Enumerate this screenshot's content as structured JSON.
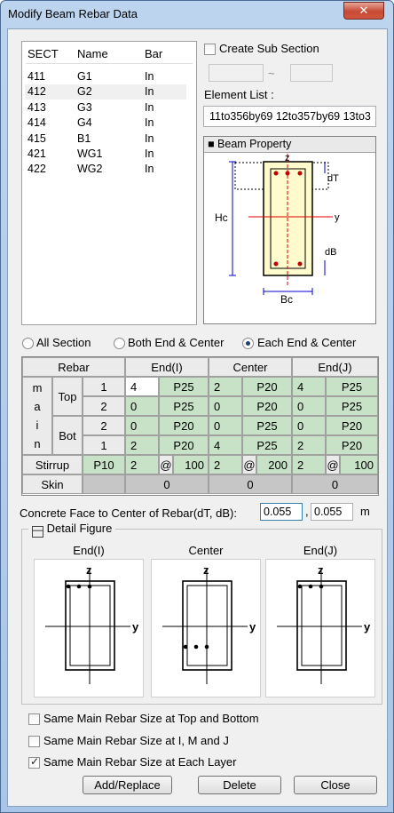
{
  "window": {
    "title": "Modify Beam Rebar Data",
    "close": "✕"
  },
  "sections": {
    "headers": [
      "SECT",
      "Name",
      "Bar"
    ],
    "rows": [
      {
        "sect": "411",
        "name": "G1",
        "bar": "In"
      },
      {
        "sect": "412",
        "name": "G2",
        "bar": "In"
      },
      {
        "sect": "413",
        "name": "G3",
        "bar": "In"
      },
      {
        "sect": "414",
        "name": "G4",
        "bar": "In"
      },
      {
        "sect": "415",
        "name": "B1",
        "bar": "In"
      },
      {
        "sect": "421",
        "name": "WG1",
        "bar": "In"
      },
      {
        "sect": "422",
        "name": "WG2",
        "bar": "In"
      }
    ]
  },
  "sub_section": {
    "label": "Create Sub Section",
    "dash": "~"
  },
  "element_list": {
    "label": "Element List :",
    "value": "11to356by69 12to357by69 13to3"
  },
  "beam_property": {
    "title": "Beam Property",
    "z": "z",
    "y": "y",
    "dT": "dT",
    "dB": "dB",
    "Hc": "Hc",
    "Bc": "Bc"
  },
  "positions": {
    "all": "All Section",
    "both": "Both End & Center",
    "each": "Each End & Center",
    "selected": "each"
  },
  "rebar_table": {
    "h_rebar": "Rebar",
    "h_endi": "End(I)",
    "h_center": "Center",
    "h_endj": "End(J)",
    "main": "m a i n",
    "top": "Top",
    "bot": "Bot",
    "rows": [
      {
        "layer": "1",
        "i_n": "4",
        "i_s": "P25",
        "c_n": "2",
        "c_s": "P20",
        "j_n": "4",
        "j_s": "P25"
      },
      {
        "layer": "2",
        "i_n": "0",
        "i_s": "P25",
        "c_n": "0",
        "c_s": "P20",
        "j_n": "0",
        "j_s": "P25"
      },
      {
        "layer": "2",
        "i_n": "0",
        "i_s": "P20",
        "c_n": "0",
        "c_s": "P25",
        "j_n": "0",
        "j_s": "P20"
      },
      {
        "layer": "1",
        "i_n": "2",
        "i_s": "P20",
        "c_n": "4",
        "c_s": "P25",
        "j_n": "2",
        "j_s": "P20"
      }
    ],
    "stirrup": {
      "label": "Stirrup",
      "size": "P10",
      "at": "@",
      "i_n": "2",
      "i_s": "100",
      "c_n": "2",
      "c_s": "200",
      "j_n": "2",
      "j_s": "100"
    },
    "skin": {
      "label": "Skin",
      "i": "0",
      "c": "0",
      "j": "0"
    }
  },
  "cover": {
    "label": "Concrete Face to Center of Rebar(dT, dB):",
    "dT": "0.055",
    "comma": ",",
    "dB": "0.055",
    "unit": "m"
  },
  "detail": {
    "label": "Detail Figure",
    "toggle": "—",
    "figs": [
      "End(I)",
      "Center",
      "End(J)"
    ],
    "z": "z",
    "y": "y"
  },
  "options": {
    "same_top_bottom": {
      "label": "Same Main Rebar Size at Top and Bottom",
      "checked": false
    },
    "same_imj": {
      "label": "Same Main Rebar Size at I, M and J",
      "checked": false
    },
    "same_layer": {
      "label": "Same Main Rebar Size at Each Layer",
      "checked": true
    }
  },
  "buttons": {
    "add": "Add/Replace",
    "delete": "Delete",
    "close": "Close"
  }
}
